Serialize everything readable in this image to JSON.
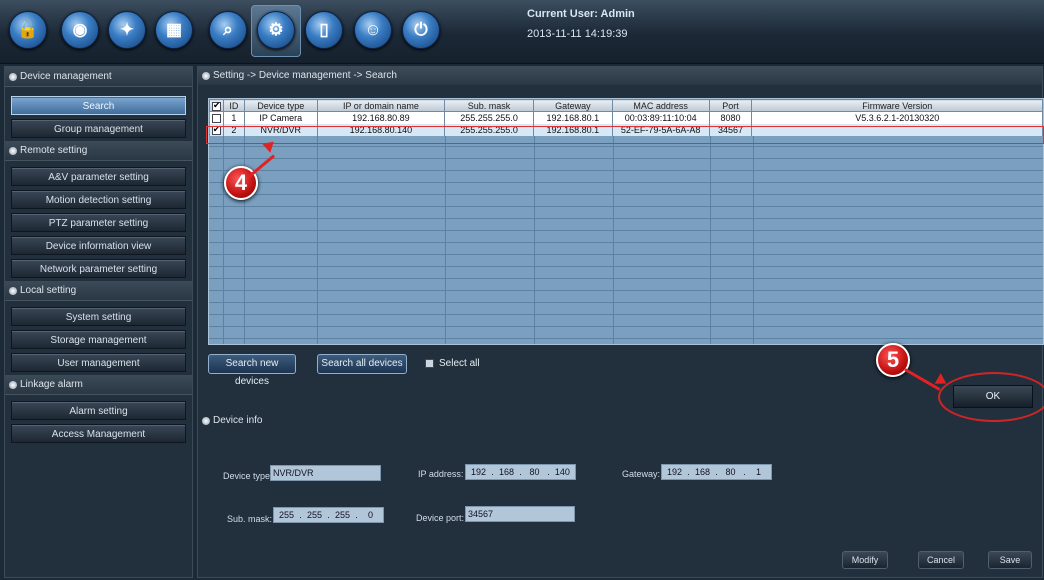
{
  "toolbar": {
    "icons": [
      {
        "name": "lock-icon",
        "glyph": "🔓"
      },
      {
        "name": "camera-icon",
        "glyph": "◉"
      },
      {
        "name": "map-icon",
        "glyph": "✦"
      },
      {
        "name": "grid-icon",
        "glyph": "▦"
      },
      {
        "name": "search-icon",
        "glyph": "⌕"
      },
      {
        "name": "gear-icon",
        "glyph": "⚙"
      },
      {
        "name": "door-icon",
        "glyph": "▯"
      },
      {
        "name": "face-icon",
        "glyph": "☺"
      },
      {
        "name": "power-icon",
        "glyph": "⏻"
      }
    ],
    "user_label": "Current User: Admin",
    "datetime": "2013-11-11 14:19:39"
  },
  "sidebar": {
    "device_management_label": "Device management",
    "search_label": "Search",
    "group_management_label": "Group management",
    "remote_setting_label": "Remote setting",
    "av_param_label": "A&V parameter setting",
    "motion_label": "Motion detection setting",
    "ptz_label": "PTZ parameter setting",
    "device_info_view_label": "Device information view",
    "network_label": "Network parameter setting",
    "local_setting_label": "Local setting",
    "system_label": "System setting",
    "storage_label": "Storage management",
    "user_mgmt_label": "User management",
    "linkage_label": "Linkage alarm",
    "alarm_setting_label": "Alarm setting",
    "access_label": "Access Management"
  },
  "main": {
    "breadcrumb": "Setting -> Device management -> Search",
    "table": {
      "headers": [
        "ID",
        "Device type",
        "IP or domain name",
        "Sub. mask",
        "Gateway",
        "MAC address",
        "Port",
        "Firmware Version"
      ],
      "rows": [
        {
          "id": "1",
          "type": "IP Camera",
          "ip": "192.168.80.89",
          "mask": "255.255.255.0",
          "gateway": "192.168.80.1",
          "mac": "00:03:89:11:10:04",
          "port": "8080",
          "fw": "V5.3.6.2.1-20130320"
        },
        {
          "id": "2",
          "type": "NVR/DVR",
          "ip": "192.168.80.140",
          "mask": "255.255.255.0",
          "gateway": "192.168.80.1",
          "mac": "52-EF-79-5A-6A-A8",
          "port": "34567",
          "fw": ""
        }
      ]
    },
    "search_new_label": "Search new devices",
    "search_all_label": "Search all devices",
    "select_all_label": "Select all",
    "ok_label": "OK",
    "device_info_label": "Device info",
    "form": {
      "device_type_label": "Device type:",
      "device_type_value": "NVR/DVR",
      "ip_label": "IP address:",
      "ip": [
        "192",
        "168",
        "80",
        "140"
      ],
      "gateway_label": "Gateway:",
      "gateway": [
        "192",
        "168",
        "80",
        "1"
      ],
      "mask_label": "Sub. mask:",
      "mask": [
        "255",
        "255",
        "255",
        "0"
      ],
      "port_label": "Device port:",
      "port_value": "34567"
    },
    "modify_label": "Modify",
    "cancel_label": "Cancel",
    "save_label": "Save"
  },
  "steps": {
    "step4": "4",
    "step5": "5"
  },
  "colors": {
    "accent": "#3e6d9c",
    "highlight": "#e03030",
    "panel": "#22303e"
  }
}
